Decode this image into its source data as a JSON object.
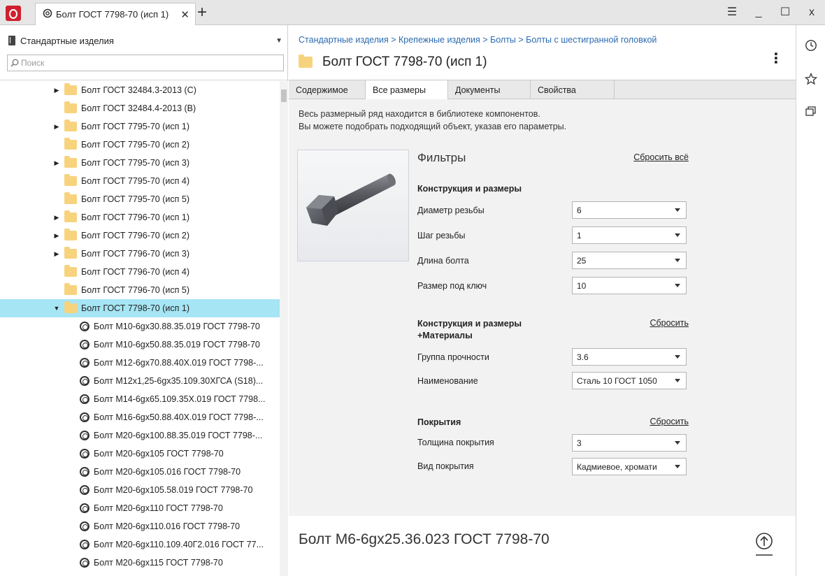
{
  "titlebar": {
    "tab_title": "Болт ГОСТ 7798-70 (исп 1)",
    "tab_close": "✕",
    "new_tab": "+",
    "menu": "☰",
    "minimize": "_",
    "maximize": "☐",
    "close": "x"
  },
  "sidebar": {
    "library": "Стандартные изделия",
    "search_placeholder": "Поиск",
    "tree": [
      {
        "label": "Болт ГОСТ 32484.3-2013 (С)",
        "type": "folder",
        "expander": "▶"
      },
      {
        "label": "Болт ГОСТ 32484.4-2013 (В)",
        "type": "folder",
        "expander": ""
      },
      {
        "label": "Болт ГОСТ 7795-70 (исп 1)",
        "type": "folder",
        "expander": "▶"
      },
      {
        "label": "Болт ГОСТ 7795-70 (исп 2)",
        "type": "folder",
        "expander": ""
      },
      {
        "label": "Болт ГОСТ 7795-70 (исп 3)",
        "type": "folder",
        "expander": "▶"
      },
      {
        "label": "Болт ГОСТ 7795-70 (исп 4)",
        "type": "folder",
        "expander": ""
      },
      {
        "label": "Болт ГОСТ 7795-70 (исп 5)",
        "type": "folder",
        "expander": ""
      },
      {
        "label": "Болт ГОСТ 7796-70 (исп 1)",
        "type": "folder",
        "expander": "▶"
      },
      {
        "label": "Болт ГОСТ 7796-70 (исп 2)",
        "type": "folder",
        "expander": "▶"
      },
      {
        "label": "Болт ГОСТ 7796-70 (исп 3)",
        "type": "folder",
        "expander": "▶"
      },
      {
        "label": "Болт ГОСТ 7796-70 (исп 4)",
        "type": "folder",
        "expander": ""
      },
      {
        "label": "Болт ГОСТ 7796-70 (исп 5)",
        "type": "folder",
        "expander": ""
      },
      {
        "label": "Болт ГОСТ 7798-70 (исп 1)",
        "type": "folder",
        "expander": "▼",
        "selected": true
      },
      {
        "label": "Болт М10-6gx30.88.35.019 ГОСТ 7798-70",
        "type": "part"
      },
      {
        "label": "Болт М10-6gx50.88.35.019 ГОСТ 7798-70",
        "type": "part"
      },
      {
        "label": "Болт М12-6gx70.88.40Х.019 ГОСТ 7798-...",
        "type": "part"
      },
      {
        "label": "Болт М12x1,25-6gx35.109.30ХГСА (S18)...",
        "type": "part"
      },
      {
        "label": "Болт М14-6gx65.109.35Х.019 ГОСТ 7798...",
        "type": "part"
      },
      {
        "label": "Болт М16-6gx50.88.40Х.019 ГОСТ 7798-...",
        "type": "part"
      },
      {
        "label": "Болт М20-6gx100.88.35.019 ГОСТ 7798-...",
        "type": "part"
      },
      {
        "label": "Болт М20-6gx105 ГОСТ 7798-70",
        "type": "part"
      },
      {
        "label": "Болт М20-6gx105.016 ГОСТ 7798-70",
        "type": "part"
      },
      {
        "label": "Болт М20-6gx105.58.019 ГОСТ 7798-70",
        "type": "part"
      },
      {
        "label": "Болт М20-6gx110 ГОСТ 7798-70",
        "type": "part"
      },
      {
        "label": "Болт М20-6gx110.016 ГОСТ 7798-70",
        "type": "part"
      },
      {
        "label": "Болт М20-6gx110.109.40Г2.016 ГОСТ 77...",
        "type": "part"
      },
      {
        "label": "Болт М20-6gx115 ГОСТ 7798-70",
        "type": "part"
      }
    ]
  },
  "main": {
    "breadcrumb": [
      "Стандартные изделия",
      "Крепежные изделия",
      "Болты",
      "Болты с шестигранной головкой"
    ],
    "breadcrumb_sep": " > ",
    "title": "Болт ГОСТ 7798-70 (исп 1)",
    "more": "⋮",
    "tabs": [
      "Содержимое",
      "Все размеры",
      "Документы",
      "Свойства"
    ],
    "active_tab": "Все размеры",
    "intro_line1": "Весь размерный ряд находится в библиотеке компонентов.",
    "intro_line2": "Вы можете подобрать подходящий объект, указав его параметры.",
    "filters_title": "Фильтры",
    "reset_all": "Сбросить всё",
    "sections": [
      {
        "title": "Конструкция и размеры",
        "reset": "",
        "fields": [
          {
            "label": "Диаметр резьбы",
            "value": "6"
          },
          {
            "label": "Шаг резьбы",
            "value": "1"
          },
          {
            "label": "Длина болта",
            "value": "25"
          },
          {
            "label": "Размер под ключ",
            "value": "10"
          }
        ]
      },
      {
        "title": "Конструкция и размеры",
        "title2": "+Материалы",
        "reset": "Сбросить",
        "fields": [
          {
            "label": "Группа прочности",
            "value": "3.6"
          },
          {
            "label": "Наименование",
            "value": "Сталь 10 ГОСТ 1050"
          }
        ]
      },
      {
        "title": "Покрытия",
        "reset": "Сбросить",
        "fields": [
          {
            "label": "Толщина покрытия",
            "value": "3"
          },
          {
            "label": "Вид покрытия",
            "value": "Кадмиевое, хромати"
          }
        ]
      }
    ],
    "result": "Болт М6-6gx25.36.023 ГОСТ 7798-70"
  },
  "colors": {
    "accent": "#2a6ab0",
    "selection": "#a6e5f4",
    "folder": "#f8d37d",
    "logo": "#d0202e"
  },
  "icons": {
    "rail": [
      "history-icon",
      "favorites-star-icon",
      "windows-icon"
    ]
  }
}
